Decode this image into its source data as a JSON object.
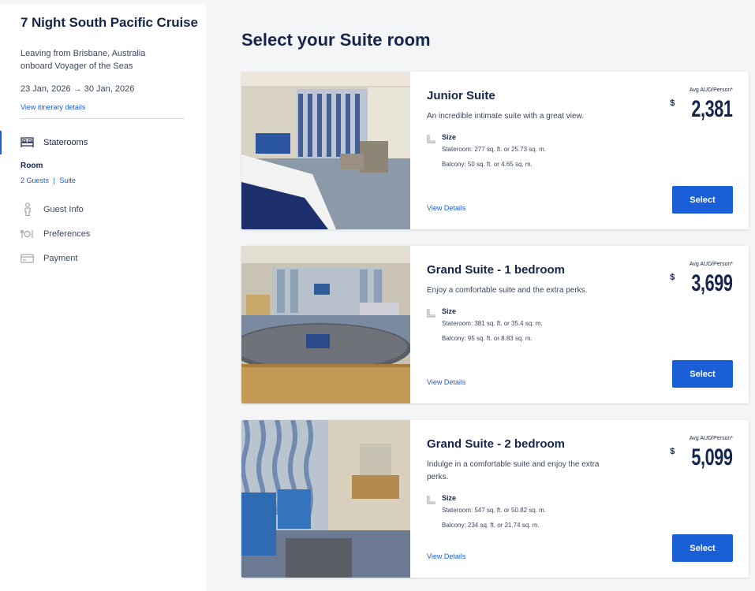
{
  "sidebar": {
    "title": "7 Night South Pacific Cruise",
    "leaving": "Leaving from Brisbane, Australia onboard Voyager of the Seas",
    "dates_start": "23 Jan, 2026",
    "dates_arrow": "→",
    "dates_end": "30 Jan, 2026",
    "itinerary_link": "View itinerary details",
    "steps": [
      {
        "label": "Staterooms",
        "icon": "bed-icon",
        "active": true
      },
      {
        "label": "Guest Info",
        "icon": "person-icon"
      },
      {
        "label": "Preferences",
        "icon": "dining-icon"
      },
      {
        "label": "Payment",
        "icon": "credit-card-icon"
      }
    ],
    "room_label": "Room",
    "room_guests": "2 Guests",
    "room_sep": "|",
    "room_type": "Suite"
  },
  "main": {
    "title": "Select your Suite room",
    "avg_label": "Avg AUD/Person*",
    "currency_symbol": "$",
    "size_label": "Size",
    "view_details": "View Details",
    "select_label": "Select",
    "rooms": [
      {
        "name": "Junior Suite",
        "description": "An incredible intimate suite with a great view.",
        "stateroom": "Stateroom: 277 sq. ft. or 25.73 sq. m.",
        "balcony": "Balcony: 50 sq. ft. or 4.65 sq. m.",
        "price": "2,381"
      },
      {
        "name": "Grand Suite - 1 bedroom",
        "description": "Enjoy a comfortable suite and the extra perks.",
        "stateroom": "Stateroom: 381 sq. ft. or 35.4 sq. m.",
        "balcony": "Balcony: 95 sq. ft. or 8.83 sq. m.",
        "price": "3,699"
      },
      {
        "name": "Grand Suite - 2 bedroom",
        "description": "Indulge in a comfortable suite and enjoy the extra perks.",
        "stateroom": "Stateroom: 547 sq. ft. or 50.82 sq. m.",
        "balcony": "Balcony: 234 sq. ft. or 21.74 sq. m.",
        "price": "5,099"
      }
    ]
  },
  "colors": {
    "navy": "#15264c",
    "link_blue": "#1d5fd1",
    "button_blue": "#1a5ed8",
    "page_bg": "#f4f5f7"
  }
}
